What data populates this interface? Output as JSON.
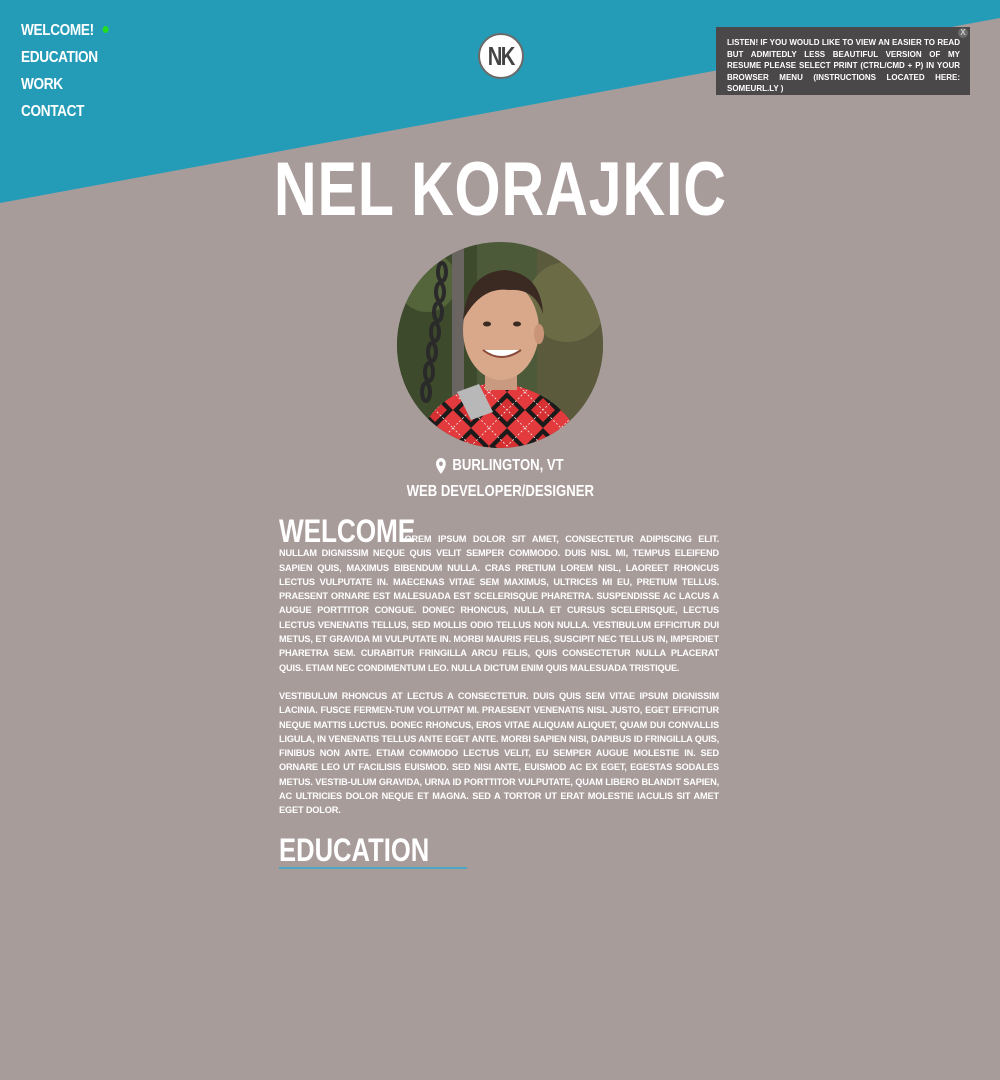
{
  "nav": {
    "items": [
      {
        "label": "WELCOME!",
        "active": true
      },
      {
        "label": "EDUCATION",
        "active": false
      },
      {
        "label": "WORK",
        "active": false
      },
      {
        "label": "CONTACT",
        "active": false
      }
    ],
    "active_dot_color": "#22dd22"
  },
  "logo": {
    "text": "NK"
  },
  "notice": {
    "text": "LISTEN! IF YOU WOULD LIKE TO VIEW AN EASIER TO READ BUT ADMITEDLY LESS BEAUTIFUL VERSION OF MY RESUME PLEASE SELECT PRINT (CTRL/CMD + P) IN YOUR BROWSER MENU (INSTRUCTIONS LOCATED HERE: SOMEURL.LY )",
    "close_label": "X"
  },
  "profile": {
    "name": "NEL KORAJKIC",
    "location": "BURLINGTON, VT",
    "role": "WEB DEVELOPER/DESIGNER"
  },
  "welcome": {
    "heading": "WELCOME",
    "paragraph1": "LOREM IPSUM DOLOR SIT AMET, CONSECTETUR ADIPISCING ELIT. NULLAM DIGNISSIM NEQUE QUIS VELIT SEMPER COMMODO. DUIS NISL MI, TEMPUS ELEIFEND SAPIEN QUIS, MAXIMUS BIBENDUM NULLA. CRAS PRETIUM LOREM NISL, LAOREET RHONCUS LECTUS VULPUTATE IN. MAECENAS VITAE SEM MAXIMUS, ULTRICES MI EU, PRETIUM TELLUS. PRAESENT ORNARE EST MALESUADA EST SCELERISQUE PHARETRA. SUSPENDISSE AC LACUS A AUGUE PORTTITOR CONGUE. DONEC RHONCUS, NULLA ET CURSUS SCELERISQUE, LECTUS LECTUS VENENATIS TELLUS, SED MOLLIS ODIO TELLUS NON NULLA. VESTIBULUM EFFICITUR DUI METUS, ET GRAVIDA MI VULPUTATE IN. MORBI MAURIS FELIS, SUSCIPIT NEC TELLUS IN, IMPERDIET PHARETRA SEM. CURABITUR FRINGILLA ARCU FELIS, QUIS CONSECTETUR NULLA PLACERAT QUIS. ETIAM NEC CONDIMENTUM LEO. NULLA DICTUM ENIM QUIS MALESUADA TRISTIQUE.",
    "paragraph2": "VESTIBULUM RHONCUS AT LECTUS A CONSECTETUR. DUIS QUIS SEM VITAE IPSUM DIGNISSIM LACINIA. FUSCE FERMEN-TUM VOLUTPAT MI. PRAESENT VENENATIS NISL JUSTO, EGET EFFICITUR NEQUE MATTIS LUCTUS. DONEC RHONCUS, EROS VITAE ALIQUAM ALIQUET, QUAM DUI CONVALLIS LIGULA, IN VENENATIS TELLUS ANTE EGET ANTE. MORBI SAPIEN NISI, DAPIBUS ID FRINGILLA QUIS, FINIBUS NON ANTE. ETIAM COMMODO LECTUS VELIT, EU SEMPER AUGUE MOLESTIE IN. SED ORNARE LEO UT FACILISIS EUISMOD. SED NISI ANTE, EUISMOD AC EX EGET, EGESTAS SODALES METUS. VESTIB-ULUM GRAVIDA, URNA ID PORTTITOR VULPUTATE, QUAM LIBERO BLANDIT SAPIEN, AC ULTRICIES DOLOR NEQUE ET MAGNA. SED A TORTOR UT ERAT MOLESTIE IACULIS SIT AMET EGET DOLOR."
  },
  "education": {
    "heading": "EDUCATION"
  },
  "icons": {
    "location": "map-pin-icon",
    "close": "close-icon"
  },
  "colors": {
    "background": "#a89c9b",
    "header_band": "#259cb7",
    "notice_bg": "#4a4848",
    "text": "#ffffff",
    "link_underline": "#4aa7c3"
  }
}
